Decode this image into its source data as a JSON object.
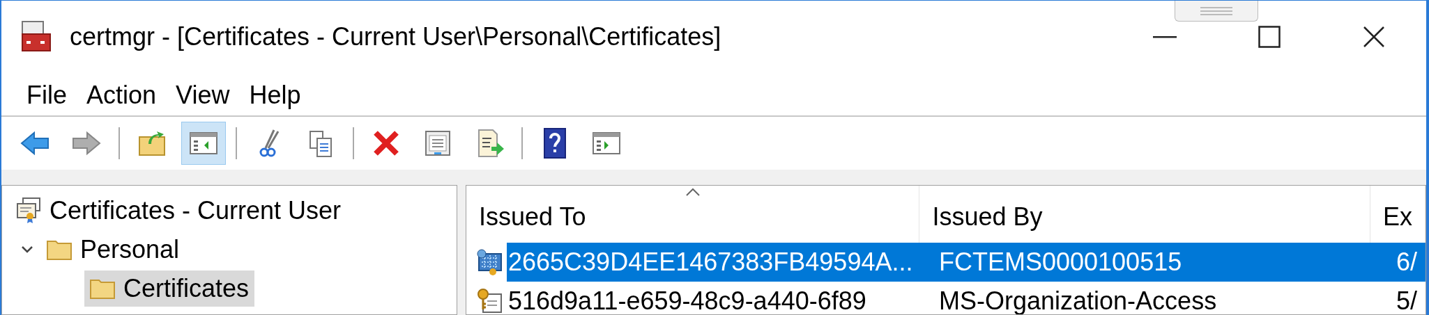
{
  "window": {
    "title": "certmgr - [Certificates - Current User\\Personal\\Certificates]"
  },
  "menu": [
    "File",
    "Action",
    "View",
    "Help"
  ],
  "toolbar": [
    {
      "buttons": [
        {
          "kind": "back",
          "disabled": false,
          "pressed": false
        },
        {
          "kind": "forward",
          "disabled": true,
          "pressed": false
        }
      ]
    },
    {
      "buttons": [
        {
          "kind": "up",
          "disabled": false,
          "pressed": false
        },
        {
          "kind": "tree",
          "disabled": false,
          "pressed": true
        }
      ]
    },
    {
      "buttons": [
        {
          "kind": "cut",
          "disabled": false,
          "pressed": false
        },
        {
          "kind": "copy",
          "disabled": false,
          "pressed": false
        }
      ]
    },
    {
      "buttons": [
        {
          "kind": "delete",
          "disabled": false,
          "pressed": false
        },
        {
          "kind": "properties",
          "disabled": false,
          "pressed": false
        },
        {
          "kind": "export",
          "disabled": false,
          "pressed": false
        }
      ]
    },
    {
      "buttons": [
        {
          "kind": "help",
          "disabled": false,
          "pressed": false
        },
        {
          "kind": "action_pane",
          "disabled": false,
          "pressed": false
        }
      ]
    }
  ],
  "tree": [
    {
      "label": "Certificates - Current User",
      "kind": "root",
      "selected": false,
      "children": [
        {
          "label": "Personal",
          "kind": "folder",
          "selected": false,
          "expanded": true,
          "children": [
            {
              "label": "Certificates",
              "kind": "folder",
              "selected": true
            }
          ]
        }
      ]
    }
  ],
  "table": {
    "columns": [
      {
        "label": "Issued To",
        "sorted": true
      },
      {
        "label": "Issued By",
        "sorted": false
      },
      {
        "label": "Ex",
        "sorted": false
      }
    ],
    "rows": [
      {
        "kind": "cert",
        "selected": true,
        "cells": [
          "2665C39D4EE1467383FB49594A...",
          "FCTEMS0000100515",
          "6/"
        ]
      },
      {
        "kind": "cert_key",
        "selected": false,
        "cells": [
          "516d9a11-e659-48c9-a440-6f89",
          "MS-Organization-Access",
          "5/"
        ]
      }
    ]
  }
}
